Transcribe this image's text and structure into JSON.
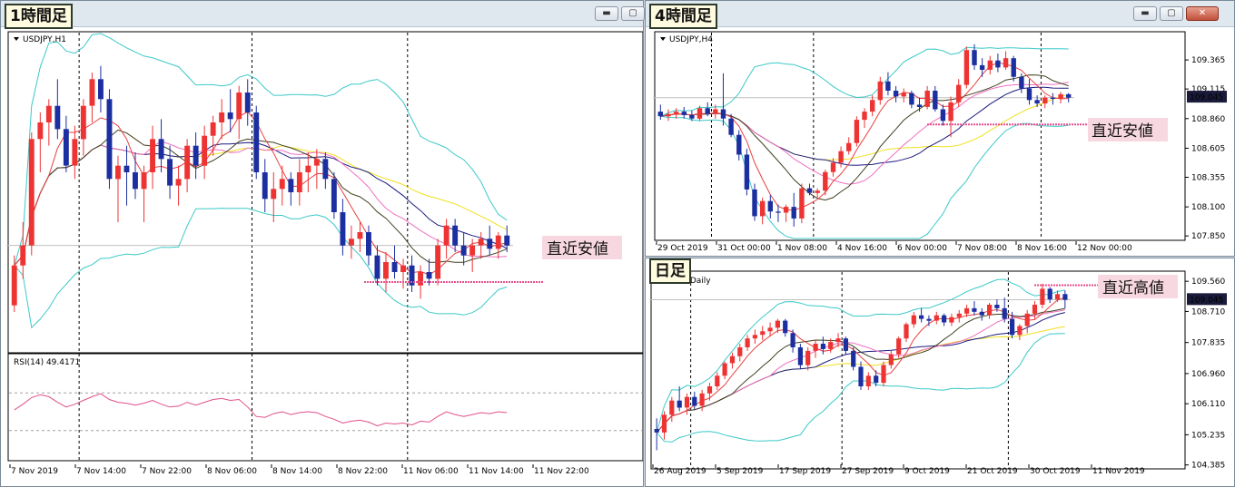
{
  "windows": [
    {
      "id": "h1",
      "timeframe_tag": "1時間足"
    },
    {
      "id": "h4",
      "timeframe_tag": "4時間足"
    },
    {
      "id": "d1",
      "timeframe_tag": "日足"
    }
  ],
  "icons": {
    "minimize": "minimize-icon",
    "maximize": "maximize-icon",
    "close": "close-icon",
    "dropdown": "triangle-down-icon"
  },
  "colors": {
    "bull": "#ee3333",
    "bear": "#1c2fa0",
    "bb": "#3cc8c8",
    "ma_red": "#e84040",
    "ma_pink": "#f070c0",
    "ma_green": "#404020",
    "ma_navy": "#1a1a80",
    "ma_yellow": "#f0e020",
    "rsi": "#e0508a",
    "pink_line": "#e8508e",
    "callout_bg": "#f8d8e0",
    "price_box": "#1a1a3a"
  },
  "chart_data": [
    {
      "id": "h1",
      "type": "candlestick",
      "symbol_label": "USDJPY,H1",
      "x_tick_labels": [
        "7 Nov 2019",
        "7 Nov 14:00",
        "7 Nov 22:00",
        "8 Nov 06:00",
        "8 Nov 14:00",
        "8 Nov 22:00",
        "11 Nov 06:00",
        "11 Nov 14:00",
        "11 Nov 22:00"
      ],
      "period_separators": [
        8,
        28,
        46
      ],
      "ohlc": [
        [
          108.8,
          108.95,
          108.78,
          108.92
        ],
        [
          108.92,
          109.05,
          108.88,
          108.98
        ],
        [
          108.98,
          109.32,
          108.95,
          109.3
        ],
        [
          109.3,
          109.38,
          109.2,
          109.35
        ],
        [
          109.35,
          109.42,
          109.28,
          109.4
        ],
        [
          109.4,
          109.48,
          109.3,
          109.33
        ],
        [
          109.33,
          109.37,
          109.2,
          109.22
        ],
        [
          109.22,
          109.34,
          109.18,
          109.3
        ],
        [
          109.3,
          109.42,
          109.25,
          109.4
        ],
        [
          109.4,
          109.5,
          109.35,
          109.48
        ],
        [
          109.48,
          109.52,
          109.38,
          109.42
        ],
        [
          109.42,
          109.45,
          109.15,
          109.18
        ],
        [
          109.18,
          109.25,
          109.05,
          109.22
        ],
        [
          109.22,
          109.28,
          109.1,
          109.2
        ],
        [
          109.2,
          109.26,
          109.12,
          109.15
        ],
        [
          109.15,
          109.22,
          109.05,
          109.2
        ],
        [
          109.2,
          109.34,
          109.15,
          109.3
        ],
        [
          109.3,
          109.36,
          109.2,
          109.24
        ],
        [
          109.24,
          109.28,
          109.12,
          109.16
        ],
        [
          109.16,
          109.22,
          109.1,
          109.18
        ],
        [
          109.18,
          109.3,
          109.14,
          109.28
        ],
        [
          109.28,
          109.32,
          109.18,
          109.22
        ],
        [
          109.22,
          109.34,
          109.18,
          109.31
        ],
        [
          109.31,
          109.37,
          109.25,
          109.35
        ],
        [
          109.35,
          109.42,
          109.3,
          109.38
        ],
        [
          109.38,
          109.45,
          109.32,
          109.36
        ],
        [
          109.36,
          109.46,
          109.3,
          109.44
        ],
        [
          109.44,
          109.48,
          109.34,
          109.38
        ],
        [
          109.38,
          109.4,
          109.18,
          109.2
        ],
        [
          109.2,
          109.24,
          109.08,
          109.12
        ],
        [
          109.12,
          109.2,
          109.05,
          109.15
        ],
        [
          109.15,
          109.22,
          109.1,
          109.18
        ],
        [
          109.18,
          109.2,
          109.1,
          109.14
        ],
        [
          109.14,
          109.24,
          109.1,
          109.2
        ],
        [
          109.2,
          109.26,
          109.14,
          109.22
        ],
        [
          109.22,
          109.27,
          109.15,
          109.24
        ],
        [
          109.24,
          109.26,
          109.15,
          109.18
        ],
        [
          109.18,
          109.2,
          109.06,
          109.08
        ],
        [
          109.08,
          109.12,
          108.95,
          108.98
        ],
        [
          108.98,
          109.04,
          108.94,
          109.0
        ],
        [
          109.0,
          109.05,
          108.96,
          109.02
        ],
        [
          109.02,
          109.04,
          108.92,
          108.95
        ],
        [
          108.95,
          108.98,
          108.86,
          108.88
        ],
        [
          108.88,
          108.96,
          108.84,
          108.93
        ],
        [
          108.93,
          108.98,
          108.88,
          108.9
        ],
        [
          108.9,
          108.94,
          108.85,
          108.92
        ],
        [
          108.92,
          108.95,
          108.84,
          108.86
        ],
        [
          108.86,
          108.92,
          108.82,
          108.9
        ],
        [
          108.9,
          108.94,
          108.86,
          108.88
        ],
        [
          108.88,
          109.0,
          108.86,
          108.98
        ],
        [
          108.98,
          109.06,
          108.94,
          109.04
        ],
        [
          109.04,
          109.06,
          108.96,
          108.98
        ],
        [
          108.98,
          109.02,
          108.92,
          108.95
        ],
        [
          108.95,
          109.0,
          108.9,
          108.98
        ],
        [
          108.98,
          109.02,
          108.94,
          109.0
        ],
        [
          109.0,
          109.04,
          108.95,
          108.97
        ],
        [
          108.97,
          109.02,
          108.94,
          109.01
        ],
        [
          109.01,
          109.04,
          108.96,
          108.98
        ]
      ],
      "rsi": {
        "label": "RSI(14) 49.4171",
        "period": 14,
        "levels": [
          70,
          30
        ],
        "values": [
          52,
          58,
          65,
          68,
          66,
          60,
          55,
          58,
          62,
          66,
          69,
          63,
          60,
          59,
          57,
          59,
          62,
          58,
          55,
          56,
          60,
          57,
          60,
          63,
          64,
          62,
          63,
          55,
          45,
          44,
          48,
          50,
          47,
          49,
          50,
          49,
          45,
          42,
          38,
          40,
          41,
          39,
          35,
          38,
          37,
          38,
          36,
          40,
          39,
          45,
          50,
          47,
          45,
          47,
          49,
          48,
          50,
          49
        ]
      },
      "pink_level": 108.87,
      "callout": "直近安値"
    },
    {
      "id": "h4",
      "type": "candlestick",
      "symbol_label": "USDJPY,H4",
      "x_tick_labels": [
        "29 Oct 2019",
        "31 Oct 00:00",
        "1 Nov 08:00",
        "4 Nov 16:00",
        "6 Nov 00:00",
        "7 Nov 08:00",
        "8 Nov 16:00",
        "12 Nov 00:00"
      ],
      "y_tick_labels": [
        109.365,
        109.115,
        108.86,
        108.605,
        108.355,
        108.1,
        107.85
      ],
      "current_price": "109.045",
      "period_separators": [
        7,
        20,
        49
      ],
      "ohlc": [
        [
          108.92,
          108.98,
          108.85,
          108.88
        ],
        [
          108.88,
          108.94,
          108.84,
          108.9
        ],
        [
          108.9,
          108.95,
          108.86,
          108.92
        ],
        [
          108.92,
          108.96,
          108.86,
          108.89
        ],
        [
          108.89,
          108.93,
          108.84,
          108.86
        ],
        [
          108.86,
          108.97,
          108.84,
          108.95
        ],
        [
          108.95,
          109.0,
          108.88,
          108.9
        ],
        [
          108.9,
          108.98,
          108.86,
          108.94
        ],
        [
          108.94,
          109.25,
          108.8,
          108.86
        ],
        [
          108.86,
          108.9,
          108.7,
          108.72
        ],
        [
          108.72,
          108.76,
          108.5,
          108.55
        ],
        [
          108.55,
          108.6,
          108.2,
          108.25
        ],
        [
          108.25,
          108.3,
          107.98,
          108.02
        ],
        [
          108.02,
          108.18,
          107.95,
          108.15
        ],
        [
          108.15,
          108.2,
          108.0,
          108.06
        ],
        [
          108.06,
          108.12,
          107.97,
          108.05
        ],
        [
          108.05,
          108.12,
          107.97,
          108.1
        ],
        [
          108.1,
          108.22,
          107.93,
          108.0
        ],
        [
          108.0,
          108.3,
          107.96,
          108.26
        ],
        [
          108.26,
          108.3,
          108.2,
          108.22
        ],
        [
          108.22,
          108.26,
          108.18,
          108.24
        ],
        [
          108.24,
          108.42,
          108.2,
          108.4
        ],
        [
          108.4,
          108.52,
          108.36,
          108.48
        ],
        [
          108.48,
          108.62,
          108.44,
          108.58
        ],
        [
          108.58,
          108.7,
          108.55,
          108.65
        ],
        [
          108.65,
          108.88,
          108.62,
          108.85
        ],
        [
          108.85,
          108.95,
          108.78,
          108.92
        ],
        [
          108.92,
          109.06,
          108.88,
          109.02
        ],
        [
          109.02,
          109.22,
          108.98,
          109.18
        ],
        [
          109.18,
          109.26,
          109.06,
          109.1
        ],
        [
          109.1,
          109.14,
          109.0,
          109.05
        ],
        [
          109.05,
          109.12,
          109.0,
          109.08
        ],
        [
          109.08,
          109.1,
          108.95,
          108.98
        ],
        [
          108.98,
          109.04,
          108.92,
          108.96
        ],
        [
          108.96,
          109.14,
          108.94,
          109.1
        ],
        [
          109.1,
          109.14,
          108.92,
          108.94
        ],
        [
          108.94,
          108.98,
          108.8,
          108.84
        ],
        [
          108.84,
          109.05,
          108.7,
          109.0
        ],
        [
          109.0,
          109.2,
          108.96,
          109.15
        ],
        [
          109.15,
          109.48,
          109.12,
          109.45
        ],
        [
          109.45,
          109.5,
          109.28,
          109.32
        ],
        [
          109.32,
          109.38,
          109.22,
          109.28
        ],
        [
          109.28,
          109.4,
          109.24,
          109.36
        ],
        [
          109.36,
          109.42,
          109.26,
          109.3
        ],
        [
          109.3,
          109.44,
          109.28,
          109.38
        ],
        [
          109.38,
          109.4,
          109.18,
          109.22
        ],
        [
          109.22,
          109.25,
          109.08,
          109.12
        ],
        [
          109.12,
          109.2,
          108.98,
          109.02
        ],
        [
          109.02,
          109.06,
          108.96,
          108.99
        ],
        [
          108.99,
          109.06,
          108.95,
          109.04
        ],
        [
          109.04,
          109.08,
          108.98,
          109.03
        ],
        [
          109.03,
          109.09,
          108.99,
          109.07
        ],
        [
          109.07,
          109.08,
          109.0,
          109.04
        ]
      ],
      "pink_level": 108.81,
      "callout": "直近安値"
    },
    {
      "id": "d1",
      "type": "candlestick",
      "symbol_label": "",
      "symbol_suffix": ",Daily",
      "x_tick_labels": [
        "26 Aug 2019",
        "5 Sep 2019",
        "17 Sep 2019",
        "27 Sep 2019",
        "9 Oct 2019",
        "21 Oct 2019",
        "30 Oct 2019",
        "11 Nov 2019"
      ],
      "y_tick_labels": [
        109.56,
        108.71,
        107.835,
        106.96,
        106.11,
        105.235,
        104.385
      ],
      "current_price": "109.045",
      "period_separators": [
        5,
        25,
        47
      ],
      "ohlc": [
        [
          105.4,
          105.7,
          104.8,
          105.3
        ],
        [
          105.3,
          105.9,
          105.1,
          105.8
        ],
        [
          105.8,
          106.3,
          105.6,
          106.2
        ],
        [
          106.2,
          106.6,
          105.9,
          106.0
        ],
        [
          106.0,
          106.4,
          105.8,
          106.3
        ],
        [
          106.3,
          106.45,
          105.95,
          106.05
        ],
        [
          106.05,
          106.5,
          105.9,
          106.4
        ],
        [
          106.4,
          106.7,
          106.2,
          106.6
        ],
        [
          106.6,
          107.0,
          106.5,
          106.9
        ],
        [
          106.9,
          107.3,
          106.8,
          107.25
        ],
        [
          107.25,
          107.55,
          107.1,
          107.45
        ],
        [
          107.45,
          107.8,
          107.3,
          107.7
        ],
        [
          107.7,
          108.05,
          107.6,
          107.95
        ],
        [
          107.95,
          108.2,
          107.8,
          108.05
        ],
        [
          108.05,
          108.3,
          107.9,
          108.15
        ],
        [
          108.15,
          108.4,
          108.0,
          108.25
        ],
        [
          108.25,
          108.5,
          108.1,
          108.45
        ],
        [
          108.45,
          108.5,
          108.0,
          108.1
        ],
        [
          108.1,
          108.2,
          107.55,
          107.7
        ],
        [
          107.7,
          107.8,
          107.1,
          107.2
        ],
        [
          107.2,
          107.7,
          107.05,
          107.6
        ],
        [
          107.6,
          107.9,
          107.4,
          107.8
        ],
        [
          107.8,
          108.0,
          107.5,
          107.65
        ],
        [
          107.65,
          107.95,
          107.55,
          107.85
        ],
        [
          107.85,
          108.1,
          107.7,
          107.95
        ],
        [
          107.95,
          108.0,
          107.5,
          107.6
        ],
        [
          107.6,
          107.7,
          107.05,
          107.15
        ],
        [
          107.15,
          107.3,
          106.5,
          106.6
        ],
        [
          106.6,
          107.0,
          106.5,
          106.9
        ],
        [
          106.9,
          107.05,
          106.6,
          106.7
        ],
        [
          106.7,
          107.3,
          106.6,
          107.2
        ],
        [
          107.2,
          107.6,
          107.1,
          107.5
        ],
        [
          107.5,
          108.0,
          107.4,
          107.95
        ],
        [
          107.95,
          108.4,
          107.85,
          108.35
        ],
        [
          108.35,
          108.7,
          108.25,
          108.6
        ],
        [
          108.6,
          108.8,
          108.4,
          108.5
        ],
        [
          108.5,
          108.6,
          108.3,
          108.45
        ],
        [
          108.45,
          108.7,
          108.35,
          108.6
        ],
        [
          108.6,
          108.65,
          108.3,
          108.4
        ],
        [
          108.4,
          108.65,
          108.3,
          108.55
        ],
        [
          108.55,
          108.75,
          108.4,
          108.65
        ],
        [
          108.65,
          108.9,
          108.55,
          108.8
        ],
        [
          108.8,
          109.0,
          108.6,
          108.7
        ],
        [
          108.7,
          108.8,
          108.45,
          108.6
        ],
        [
          108.6,
          108.95,
          108.5,
          108.9
        ],
        [
          108.9,
          109.05,
          108.7,
          108.8
        ],
        [
          108.8,
          109.1,
          108.4,
          108.5
        ],
        [
          108.5,
          108.7,
          107.95,
          108.05
        ],
        [
          108.05,
          108.35,
          107.9,
          108.3
        ],
        [
          108.3,
          108.75,
          108.1,
          108.65
        ],
        [
          108.65,
          109.0,
          108.5,
          108.9
        ],
        [
          108.9,
          109.49,
          108.8,
          109.35
        ],
        [
          109.35,
          109.4,
          108.95,
          109.05
        ],
        [
          109.05,
          109.3,
          108.98,
          109.2
        ],
        [
          109.2,
          109.3,
          108.8,
          109.04
        ]
      ],
      "pink_level": 109.45,
      "callout": "直近高値"
    }
  ]
}
